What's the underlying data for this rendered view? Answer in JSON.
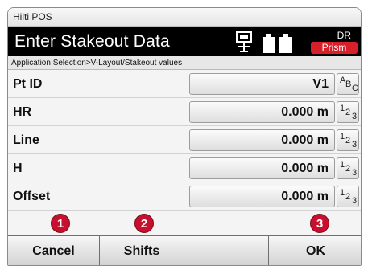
{
  "app": {
    "window_title": "Hilti POS"
  },
  "header": {
    "title": "Enter Stakeout Data",
    "status_dr": "DR",
    "status_target": "Prism",
    "icons": [
      "prism-pole-icon",
      "battery-icon"
    ]
  },
  "breadcrumb": "Application Selection>V-Layout/Stakeout values",
  "fields": [
    {
      "label": "Pt ID",
      "value": "V1",
      "input_mode": [
        "A",
        "B",
        "C"
      ]
    },
    {
      "label": "HR",
      "value": "0.000 m",
      "input_mode": [
        "1",
        "2",
        "3"
      ]
    },
    {
      "label": "Line",
      "value": "0.000 m",
      "input_mode": [
        "1",
        "2",
        "3"
      ]
    },
    {
      "label": "H",
      "value": "0.000 m",
      "input_mode": [
        "1",
        "2",
        "3"
      ]
    },
    {
      "label": "Offset",
      "value": "0.000 m",
      "input_mode": [
        "1",
        "2",
        "3"
      ]
    }
  ],
  "softkeys": [
    {
      "label": "Cancel"
    },
    {
      "label": "Shifts"
    },
    {
      "label": ""
    },
    {
      "label": "OK"
    }
  ],
  "callouts": [
    "1",
    "2",
    "3"
  ],
  "colors": {
    "header_bg": "#000000",
    "prism_badge": "#d8202a",
    "callout": "#c8102e"
  }
}
